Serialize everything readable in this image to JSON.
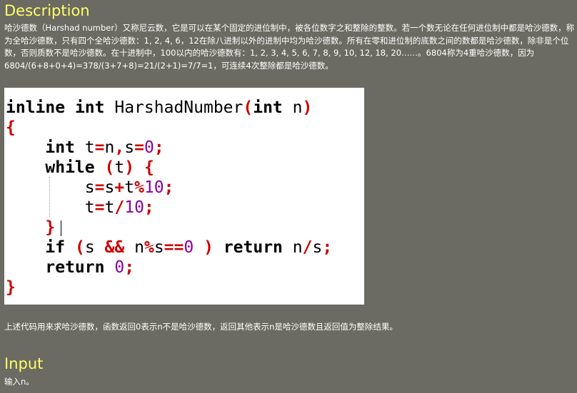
{
  "description": {
    "heading": "Description",
    "paragraph": "哈沙德数（Harshad number）又称尼云数，它是可以在某个固定的进位制中，被各位数字之和整除的整数。若一个数无论在任何进位制中都是哈沙德数，称为全哈沙德数，只有四个全哈沙德数：1, 2, 4, 6，12在除八进制以外的进制中均为哈沙德数。所有在零和进位制的底数之间的数都是哈沙德数，除非是个位数，否则质数不是哈沙德数。在十进制中，100以内的哈沙德数有：1, 2, 3, 4, 5, 6, 7, 8, 9, 10, 12, 18, 20……。6804称为4重哈沙德数，因为6804/(6+8+0+4)=378/(3+7+8)=21/(2+1)=7/7=1，可连续4次整除都是哈沙德数。"
  },
  "code": {
    "tokens": {
      "inline": "inline",
      "int": "int",
      "fname": "HarshadNumber",
      "lparen": "(",
      "rparen": ")",
      "n": "n",
      "lbrace": "{",
      "rbrace": "}",
      "t": "t",
      "s": "s",
      "eq": "=",
      "comma": ",",
      "zero": "0",
      "semi": ";",
      "while": "while",
      "plus": "+",
      "mod": "%",
      "ten": "10",
      "div": "/",
      "and": "&&",
      "eqeq": "==",
      "return": "return"
    }
  },
  "note": "上述代码用来求哈沙德数，函数返回0表示n不是哈沙德数，返回其他表示n是哈沙德数且返回值为整除结果。",
  "input": {
    "heading": "Input",
    "paragraph": "输入n。"
  }
}
